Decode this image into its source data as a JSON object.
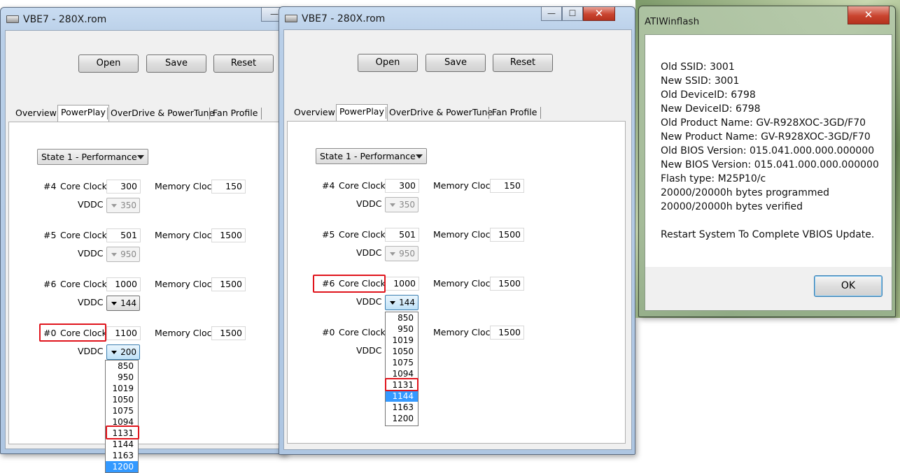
{
  "window1": {
    "title": "VBE7 - 280X.rom",
    "buttons": {
      "open": "Open",
      "save": "Save",
      "reset": "Reset"
    },
    "tabs": [
      "Overview",
      "PowerPlay",
      "OverDrive & PowerTune",
      "Fan Profile"
    ],
    "state_select": "State 1 - Performance",
    "rows": [
      {
        "id": "#4",
        "core_label": "Core Clock",
        "core": "300",
        "mem_label": "Memory Clock",
        "mem": "150",
        "vddc_label": "VDDC",
        "vddc": "350"
      },
      {
        "id": "#5",
        "core_label": "Core Clock",
        "core": "501",
        "mem_label": "Memory Clock",
        "mem": "1500",
        "vddc_label": "VDDC",
        "vddc": "950"
      },
      {
        "id": "#6",
        "core_label": "Core Clock",
        "core": "1000",
        "mem_label": "Memory Clock",
        "mem": "1500",
        "vddc_label": "VDDC",
        "vddc": "144"
      },
      {
        "id": "#0",
        "core_label": "Core Clock",
        "core": "1100",
        "mem_label": "Memory Clock",
        "mem": "1500",
        "vddc_label": "VDDC",
        "vddc": "200"
      }
    ],
    "dropdown": [
      "850",
      "950",
      "1019",
      "1050",
      "1075",
      "1094",
      "1131",
      "1144",
      "1163",
      "1200"
    ],
    "dropdown_selected": "1200"
  },
  "window2": {
    "title": "VBE7 - 280X.rom",
    "buttons": {
      "open": "Open",
      "save": "Save",
      "reset": "Reset"
    },
    "tabs": [
      "Overview",
      "PowerPlay",
      "OverDrive & PowerTune",
      "Fan Profile"
    ],
    "state_select": "State 1 - Performance",
    "rows": [
      {
        "id": "#4",
        "core_label": "Core Clock",
        "core": "300",
        "mem_label": "Memory Clock",
        "mem": "150",
        "vddc_label": "VDDC",
        "vddc": "350"
      },
      {
        "id": "#5",
        "core_label": "Core Clock",
        "core": "501",
        "mem_label": "Memory Clock",
        "mem": "1500",
        "vddc_label": "VDDC",
        "vddc": "950"
      },
      {
        "id": "#6",
        "core_label": "Core Clock",
        "core": "1000",
        "mem_label": "Memory Clock",
        "mem": "1500",
        "vddc_label": "VDDC",
        "vddc": "144"
      },
      {
        "id": "#0",
        "core_label": "Core Clock",
        "core": "",
        "mem_label": "Memory Clock",
        "mem": "1500",
        "vddc_label": "VDDC",
        "vddc": ""
      }
    ],
    "dropdown": [
      "850",
      "950",
      "1019",
      "1050",
      "1075",
      "1094",
      "1131",
      "1144",
      "1163",
      "1200"
    ],
    "dropdown_selected": "1144"
  },
  "atiwinflash": {
    "title": "ATIWinflash",
    "close": "✕",
    "lines": [
      "Old SSID: 3001",
      "New SSID: 3001",
      "Old DeviceID: 6798",
      "New DeviceID: 6798",
      "Old Product Name: GV-R928XOC-3GD/F70",
      "New Product Name: GV-R928XOC-3GD/F70",
      "Old BIOS Version: 015.041.000.000.000000",
      "New BIOS Version: 015.041.000.000.000000",
      "Flash type: M25P10/c",
      "20000/20000h bytes programmed",
      "20000/20000h bytes verified"
    ],
    "message": "Restart System To Complete VBIOS Update.",
    "ok": "OK"
  },
  "window_controls": {
    "minimize": "—",
    "maximize": "☐",
    "close": "✕"
  }
}
